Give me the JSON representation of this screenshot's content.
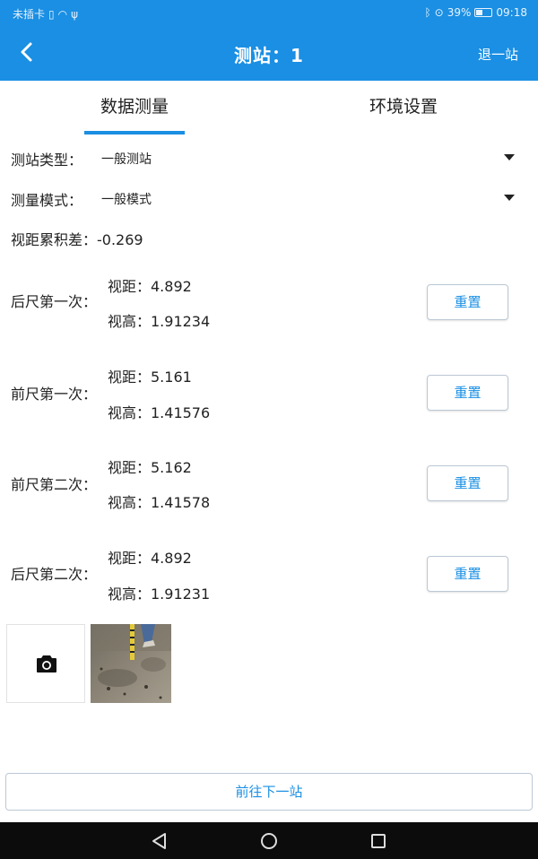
{
  "status_bar": {
    "left_text": "未插卡",
    "battery": "39%",
    "time": "09:18"
  },
  "header": {
    "title": "测站：1",
    "exit_label": "退一站"
  },
  "tabs": [
    {
      "label": "数据测量",
      "active": true
    },
    {
      "label": "环境设置",
      "active": false
    }
  ],
  "form": {
    "station_type_label": "测站类型：",
    "station_type_value": "一般测站",
    "mode_label": "测量模式：",
    "mode_value": "一般模式",
    "cumulative_label": "视距累积差：",
    "cumulative_value": "-0.269"
  },
  "measurements": [
    {
      "label": "后尺第一次：",
      "distance": "视距：4.892",
      "height": "视高：1.91234",
      "reset_label": "重置"
    },
    {
      "label": "前尺第一次：",
      "distance": "视距：5.161",
      "height": "视高：1.41576",
      "reset_label": "重置"
    },
    {
      "label": "前尺第二次：",
      "distance": "视距：5.162",
      "height": "视高：1.41578",
      "reset_label": "重置"
    },
    {
      "label": "后尺第二次：",
      "distance": "视距：4.892",
      "height": "视高：1.91231",
      "reset_label": "重置"
    }
  ],
  "photos": {
    "add_icon": "camera-icon"
  },
  "footer": {
    "next_label": "前往下一站"
  },
  "colors": {
    "accent": "#1a8fe3",
    "navbar": "#0c0c0c"
  }
}
